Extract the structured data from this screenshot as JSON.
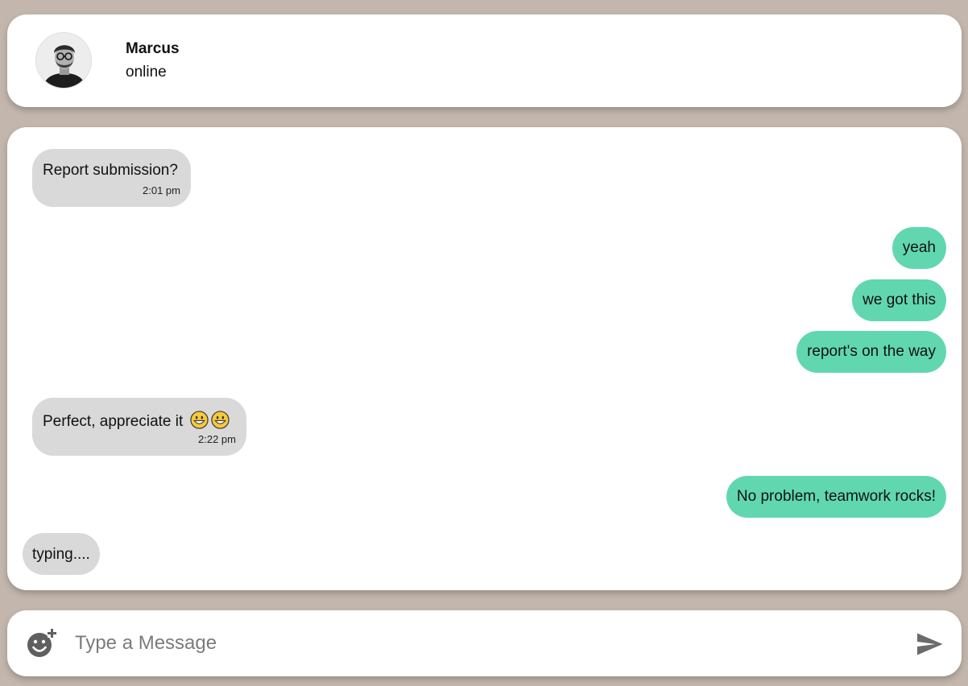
{
  "contact": {
    "name": "Marcus",
    "status": "online"
  },
  "messages": [
    {
      "direction": "incoming",
      "text": "Report submission?",
      "time": "2:01 pm"
    },
    {
      "direction": "outgoing",
      "text": "yeah"
    },
    {
      "direction": "outgoing",
      "text": "we got this"
    },
    {
      "direction": "outgoing",
      "text": "report's on the way"
    },
    {
      "direction": "incoming",
      "text": "Perfect, appreciate it",
      "emoji": [
        "grinning-face-emoji",
        "grinning-face-emoji"
      ],
      "time": "2:22 pm"
    },
    {
      "direction": "outgoing",
      "text": "No problem, teamwork rocks!"
    }
  ],
  "typing_indicator": "typing....",
  "composer": {
    "placeholder": "Type a Message",
    "value": "",
    "emoji_button_icon": "add-emoji-icon",
    "send_button_icon": "send-icon"
  },
  "colors": {
    "background": "#c3b7ad",
    "incoming_bubble": "#d9d9d9",
    "outgoing_bubble": "#61d7b0",
    "card": "#ffffff"
  }
}
